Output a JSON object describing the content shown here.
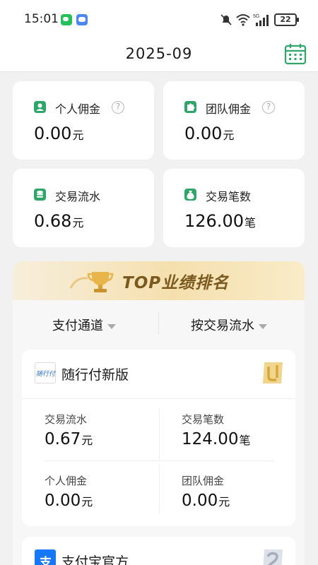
{
  "status_bar": {
    "time": "15:01",
    "battery": "22"
  },
  "header": {
    "title": "2025-09"
  },
  "summary_cards": [
    {
      "label": "个人佣金",
      "value": "0.00",
      "unit": "元",
      "help": "?"
    },
    {
      "label": "团队佣金",
      "value": "0.00",
      "unit": "元",
      "help": "?"
    },
    {
      "label": "交易流水",
      "value": "0.68",
      "unit": "元"
    },
    {
      "label": "交易笔数",
      "value": "126.00",
      "unit": "笔"
    }
  ],
  "top_ranking": {
    "title": "TOP业绩排名",
    "filters": [
      {
        "label": "支付通道"
      },
      {
        "label": "按交易流水"
      }
    ],
    "channels": [
      {
        "name": "随行付新版",
        "logo_text": "随行付",
        "metrics": [
          {
            "label": "交易流水",
            "value": "0.67",
            "unit": "元"
          },
          {
            "label": "交易笔数",
            "value": "124.00",
            "unit": "笔"
          },
          {
            "label": "个人佣金",
            "value": "0.00",
            "unit": "元"
          },
          {
            "label": "团队佣金",
            "value": "0.00",
            "unit": "元"
          }
        ]
      },
      {
        "name": "支付宝官方",
        "logo_text": "支"
      }
    ]
  },
  "colors": {
    "accent": "#2fa56a",
    "banner_gold": "#f5dfae",
    "title_brown": "#7a5a1e"
  }
}
